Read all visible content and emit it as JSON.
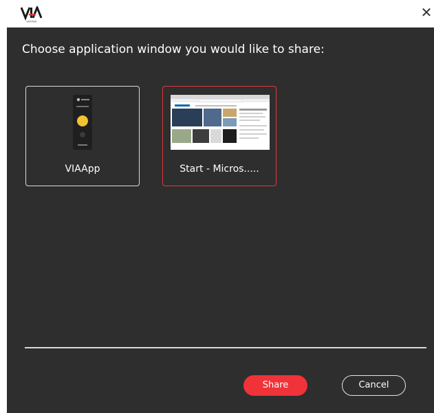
{
  "titlebar": {
    "logo_text": "VIA",
    "logo_subtext": "KRAMER",
    "close_label": "✕",
    "close_icon": "close-icon"
  },
  "dialog": {
    "prompt": "Choose application window you would like to share:",
    "windows": [
      {
        "label": "VIAApp",
        "selected": false
      },
      {
        "label": "Start - Micros.....",
        "selected": true
      }
    ],
    "share_label": "Share",
    "cancel_label": "Cancel"
  },
  "colors": {
    "background": "#2e2e2e",
    "accent": "#ef3339",
    "text": "#ffffff"
  }
}
